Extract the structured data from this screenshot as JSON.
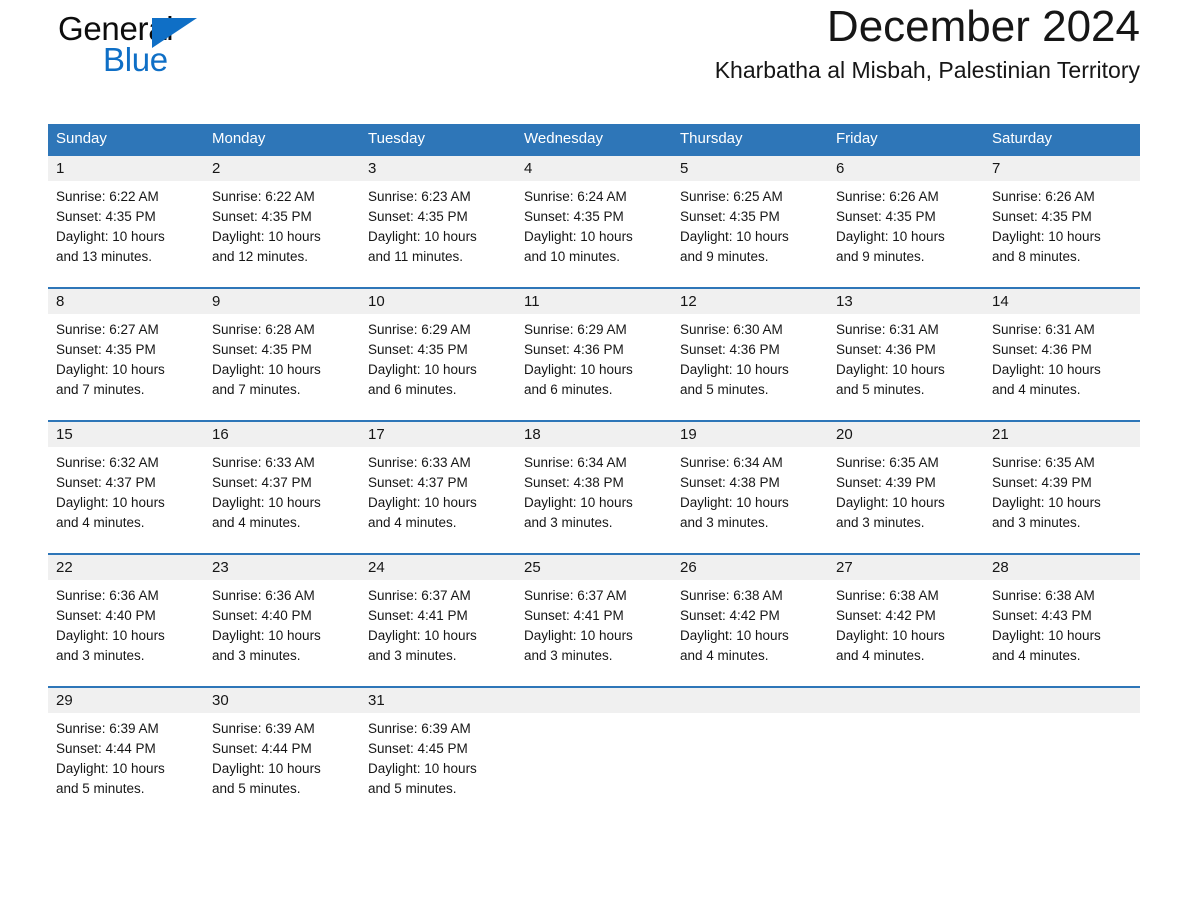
{
  "brand": {
    "name_part1": "General",
    "name_part2": "Blue",
    "logo_icon": "triangle-flag-icon",
    "accent_color": "#0f6fc6"
  },
  "header": {
    "month_title": "December 2024",
    "location": "Kharbatha al Misbah, Palestinian Territory",
    "header_bg_color": "#2e76b8",
    "daynum_bg_color": "#f0f0f0"
  },
  "weekdays": [
    "Sunday",
    "Monday",
    "Tuesday",
    "Wednesday",
    "Thursday",
    "Friday",
    "Saturday"
  ],
  "weeks": [
    {
      "days": [
        {
          "num": "1",
          "sunrise": "Sunrise: 6:22 AM",
          "sunset": "Sunset: 4:35 PM",
          "daylight_line1": "Daylight: 10 hours",
          "daylight_line2": "and 13 minutes."
        },
        {
          "num": "2",
          "sunrise": "Sunrise: 6:22 AM",
          "sunset": "Sunset: 4:35 PM",
          "daylight_line1": "Daylight: 10 hours",
          "daylight_line2": "and 12 minutes."
        },
        {
          "num": "3",
          "sunrise": "Sunrise: 6:23 AM",
          "sunset": "Sunset: 4:35 PM",
          "daylight_line1": "Daylight: 10 hours",
          "daylight_line2": "and 11 minutes."
        },
        {
          "num": "4",
          "sunrise": "Sunrise: 6:24 AM",
          "sunset": "Sunset: 4:35 PM",
          "daylight_line1": "Daylight: 10 hours",
          "daylight_line2": "and 10 minutes."
        },
        {
          "num": "5",
          "sunrise": "Sunrise: 6:25 AM",
          "sunset": "Sunset: 4:35 PM",
          "daylight_line1": "Daylight: 10 hours",
          "daylight_line2": "and 9 minutes."
        },
        {
          "num": "6",
          "sunrise": "Sunrise: 6:26 AM",
          "sunset": "Sunset: 4:35 PM",
          "daylight_line1": "Daylight: 10 hours",
          "daylight_line2": "and 9 minutes."
        },
        {
          "num": "7",
          "sunrise": "Sunrise: 6:26 AM",
          "sunset": "Sunset: 4:35 PM",
          "daylight_line1": "Daylight: 10 hours",
          "daylight_line2": "and 8 minutes."
        }
      ]
    },
    {
      "days": [
        {
          "num": "8",
          "sunrise": "Sunrise: 6:27 AM",
          "sunset": "Sunset: 4:35 PM",
          "daylight_line1": "Daylight: 10 hours",
          "daylight_line2": "and 7 minutes."
        },
        {
          "num": "9",
          "sunrise": "Sunrise: 6:28 AM",
          "sunset": "Sunset: 4:35 PM",
          "daylight_line1": "Daylight: 10 hours",
          "daylight_line2": "and 7 minutes."
        },
        {
          "num": "10",
          "sunrise": "Sunrise: 6:29 AM",
          "sunset": "Sunset: 4:35 PM",
          "daylight_line1": "Daylight: 10 hours",
          "daylight_line2": "and 6 minutes."
        },
        {
          "num": "11",
          "sunrise": "Sunrise: 6:29 AM",
          "sunset": "Sunset: 4:36 PM",
          "daylight_line1": "Daylight: 10 hours",
          "daylight_line2": "and 6 minutes."
        },
        {
          "num": "12",
          "sunrise": "Sunrise: 6:30 AM",
          "sunset": "Sunset: 4:36 PM",
          "daylight_line1": "Daylight: 10 hours",
          "daylight_line2": "and 5 minutes."
        },
        {
          "num": "13",
          "sunrise": "Sunrise: 6:31 AM",
          "sunset": "Sunset: 4:36 PM",
          "daylight_line1": "Daylight: 10 hours",
          "daylight_line2": "and 5 minutes."
        },
        {
          "num": "14",
          "sunrise": "Sunrise: 6:31 AM",
          "sunset": "Sunset: 4:36 PM",
          "daylight_line1": "Daylight: 10 hours",
          "daylight_line2": "and 4 minutes."
        }
      ]
    },
    {
      "days": [
        {
          "num": "15",
          "sunrise": "Sunrise: 6:32 AM",
          "sunset": "Sunset: 4:37 PM",
          "daylight_line1": "Daylight: 10 hours",
          "daylight_line2": "and 4 minutes."
        },
        {
          "num": "16",
          "sunrise": "Sunrise: 6:33 AM",
          "sunset": "Sunset: 4:37 PM",
          "daylight_line1": "Daylight: 10 hours",
          "daylight_line2": "and 4 minutes."
        },
        {
          "num": "17",
          "sunrise": "Sunrise: 6:33 AM",
          "sunset": "Sunset: 4:37 PM",
          "daylight_line1": "Daylight: 10 hours",
          "daylight_line2": "and 4 minutes."
        },
        {
          "num": "18",
          "sunrise": "Sunrise: 6:34 AM",
          "sunset": "Sunset: 4:38 PM",
          "daylight_line1": "Daylight: 10 hours",
          "daylight_line2": "and 3 minutes."
        },
        {
          "num": "19",
          "sunrise": "Sunrise: 6:34 AM",
          "sunset": "Sunset: 4:38 PM",
          "daylight_line1": "Daylight: 10 hours",
          "daylight_line2": "and 3 minutes."
        },
        {
          "num": "20",
          "sunrise": "Sunrise: 6:35 AM",
          "sunset": "Sunset: 4:39 PM",
          "daylight_line1": "Daylight: 10 hours",
          "daylight_line2": "and 3 minutes."
        },
        {
          "num": "21",
          "sunrise": "Sunrise: 6:35 AM",
          "sunset": "Sunset: 4:39 PM",
          "daylight_line1": "Daylight: 10 hours",
          "daylight_line2": "and 3 minutes."
        }
      ]
    },
    {
      "days": [
        {
          "num": "22",
          "sunrise": "Sunrise: 6:36 AM",
          "sunset": "Sunset: 4:40 PM",
          "daylight_line1": "Daylight: 10 hours",
          "daylight_line2": "and 3 minutes."
        },
        {
          "num": "23",
          "sunrise": "Sunrise: 6:36 AM",
          "sunset": "Sunset: 4:40 PM",
          "daylight_line1": "Daylight: 10 hours",
          "daylight_line2": "and 3 minutes."
        },
        {
          "num": "24",
          "sunrise": "Sunrise: 6:37 AM",
          "sunset": "Sunset: 4:41 PM",
          "daylight_line1": "Daylight: 10 hours",
          "daylight_line2": "and 3 minutes."
        },
        {
          "num": "25",
          "sunrise": "Sunrise: 6:37 AM",
          "sunset": "Sunset: 4:41 PM",
          "daylight_line1": "Daylight: 10 hours",
          "daylight_line2": "and 3 minutes."
        },
        {
          "num": "26",
          "sunrise": "Sunrise: 6:38 AM",
          "sunset": "Sunset: 4:42 PM",
          "daylight_line1": "Daylight: 10 hours",
          "daylight_line2": "and 4 minutes."
        },
        {
          "num": "27",
          "sunrise": "Sunrise: 6:38 AM",
          "sunset": "Sunset: 4:42 PM",
          "daylight_line1": "Daylight: 10 hours",
          "daylight_line2": "and 4 minutes."
        },
        {
          "num": "28",
          "sunrise": "Sunrise: 6:38 AM",
          "sunset": "Sunset: 4:43 PM",
          "daylight_line1": "Daylight: 10 hours",
          "daylight_line2": "and 4 minutes."
        }
      ]
    },
    {
      "days": [
        {
          "num": "29",
          "sunrise": "Sunrise: 6:39 AM",
          "sunset": "Sunset: 4:44 PM",
          "daylight_line1": "Daylight: 10 hours",
          "daylight_line2": "and 5 minutes."
        },
        {
          "num": "30",
          "sunrise": "Sunrise: 6:39 AM",
          "sunset": "Sunset: 4:44 PM",
          "daylight_line1": "Daylight: 10 hours",
          "daylight_line2": "and 5 minutes."
        },
        {
          "num": "31",
          "sunrise": "Sunrise: 6:39 AM",
          "sunset": "Sunset: 4:45 PM",
          "daylight_line1": "Daylight: 10 hours",
          "daylight_line2": "and 5 minutes."
        },
        {
          "num": "",
          "sunrise": "",
          "sunset": "",
          "daylight_line1": "",
          "daylight_line2": ""
        },
        {
          "num": "",
          "sunrise": "",
          "sunset": "",
          "daylight_line1": "",
          "daylight_line2": ""
        },
        {
          "num": "",
          "sunrise": "",
          "sunset": "",
          "daylight_line1": "",
          "daylight_line2": ""
        },
        {
          "num": "",
          "sunrise": "",
          "sunset": "",
          "daylight_line1": "",
          "daylight_line2": ""
        }
      ]
    }
  ]
}
